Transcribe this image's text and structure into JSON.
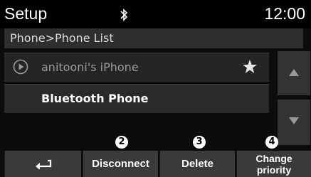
{
  "status_bar": {
    "title": "Setup",
    "clock": "12:00",
    "bluetooth_icon": "bluetooth-icon"
  },
  "breadcrumb": "Phone>Phone List",
  "phone_list": [
    {
      "name": "anitooni's iPhone",
      "icon": "play-circle-icon",
      "favorite_icon": "star-icon",
      "selected": true
    },
    {
      "name": "Bluetooth Phone"
    }
  ],
  "scroll": {
    "up_icon": "triangle-up-icon",
    "down_icon": "triangle-down-icon"
  },
  "markers": [
    "2",
    "3",
    "4"
  ],
  "buttons": {
    "back_icon": "back-arrow-icon",
    "disconnect": "Disconnect",
    "delete": "Delete",
    "change_priority_line1": "Change",
    "change_priority_line2": "priority"
  },
  "colors": {
    "background": "#0c0c0c",
    "button": "#3a3a3a",
    "list_item": "#2a2a2a",
    "text": "#ffffff"
  }
}
